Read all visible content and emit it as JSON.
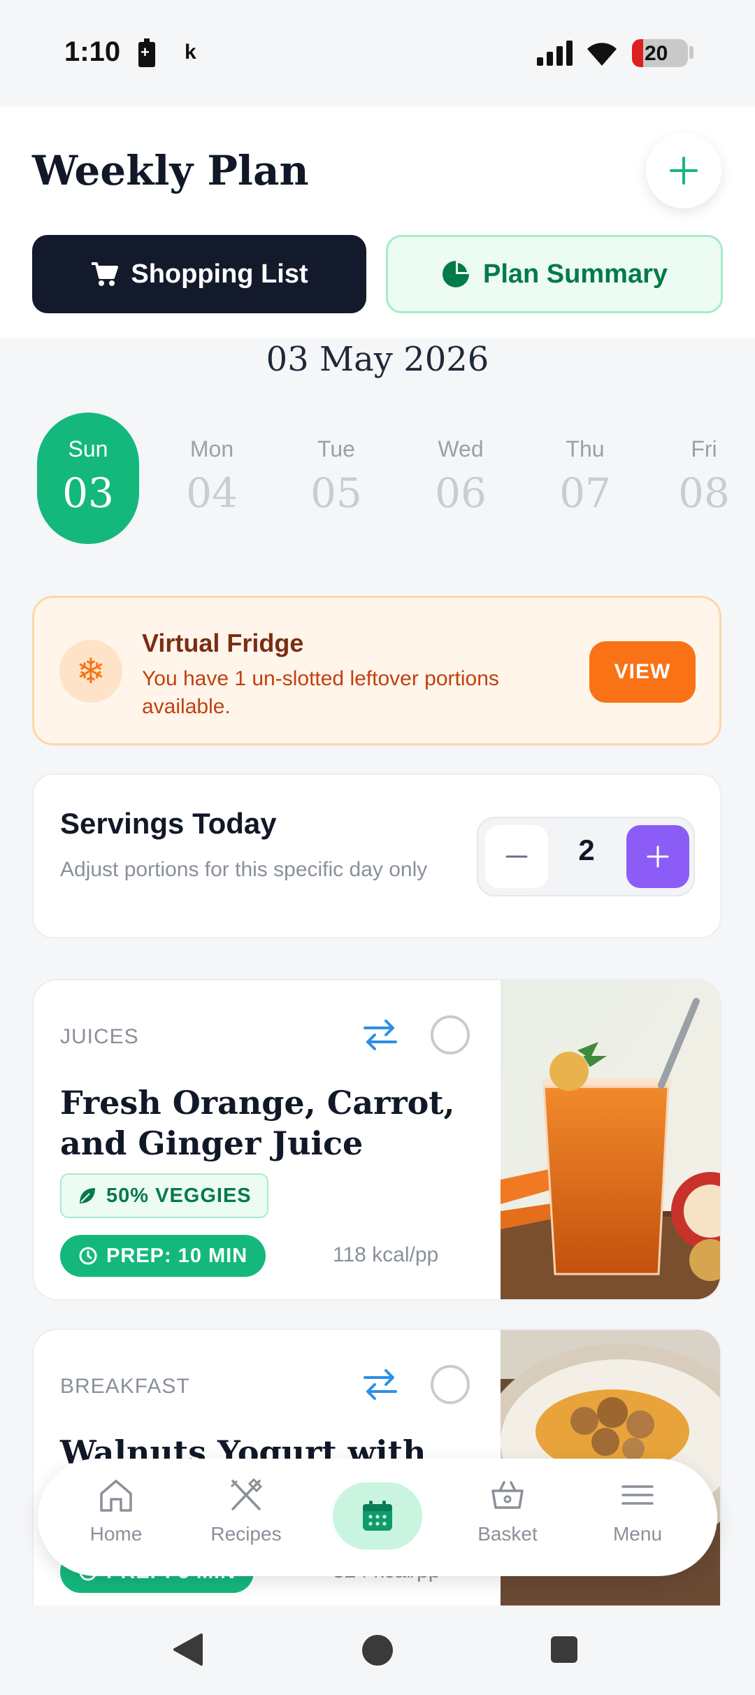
{
  "status_bar": {
    "time": "1:10",
    "notification_letter": "k",
    "battery_level": "20"
  },
  "header": {
    "title": "Weekly Plan",
    "shopping_list_label": "Shopping List",
    "plan_summary_label": "Plan Summary"
  },
  "date": {
    "current": "03 May 2026",
    "days": [
      {
        "name": "Sun",
        "num": "03",
        "active": true
      },
      {
        "name": "Mon",
        "num": "04",
        "active": false
      },
      {
        "name": "Tue",
        "num": "05",
        "active": false
      },
      {
        "name": "Wed",
        "num": "06",
        "active": false
      },
      {
        "name": "Thu",
        "num": "07",
        "active": false
      },
      {
        "name": "Fri",
        "num": "08",
        "active": false
      }
    ]
  },
  "fridge": {
    "title": "Virtual Fridge",
    "message": "You have 1 un-slotted leftover portions available.",
    "button": "VIEW"
  },
  "servings": {
    "title": "Servings Today",
    "subtitle": "Adjust portions for this specific day only",
    "value": "2"
  },
  "recipes": [
    {
      "category": "JUICES",
      "title": "Fresh Orange, Carrot, and Ginger Juice",
      "veggies": "50% VEGGIES",
      "prep": "PREP: 10 MIN",
      "kcal": "118 kcal/pp",
      "image": "orange-carrot-juice-photo"
    },
    {
      "category": "BREAKFAST",
      "title": "Walnuts Yogurt with",
      "prep": "PREP: 5 MIN",
      "kcal": "324 kcal/pp",
      "image": "walnut-yogurt-bowl-photo"
    }
  ],
  "bottom_nav": {
    "items": [
      {
        "label": "Home",
        "icon": "home-icon"
      },
      {
        "label": "Recipes",
        "icon": "utensils-icon"
      },
      {
        "label": "",
        "icon": "calendar-icon",
        "active": true
      },
      {
        "label": "Basket",
        "icon": "basket-icon"
      },
      {
        "label": "Menu",
        "icon": "menu-icon"
      }
    ]
  },
  "colors": {
    "accent_green": "#14b87d",
    "dark_navy": "#131a2b",
    "orange": "#f97316",
    "purple": "#8b5cf6"
  }
}
